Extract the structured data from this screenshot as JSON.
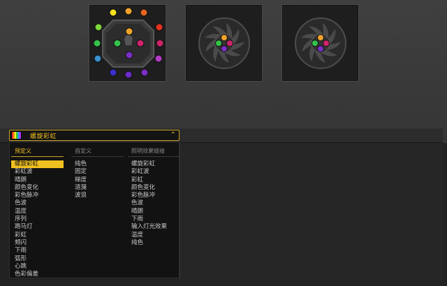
{
  "devices": [
    {
      "name": "fan-controller",
      "ring_leds": [
        "#f5e11d",
        "#f0a32a",
        "#e5651f",
        "#e3311f",
        "#d0236b",
        "#b43ac4",
        "#7a2fc4",
        "#6a2cc6",
        "#3a30c8",
        "#3a8fd0",
        "#34c24a",
        "#7fd63a"
      ],
      "hub_leds": [
        "#f0a32a",
        "#d0236b",
        "#7a2fc4",
        "#34c24a"
      ]
    },
    {
      "name": "fan-1",
      "hub_leds": [
        "#f0a32a",
        "#d0236b",
        "#7a2fc4",
        "#34c24a"
      ]
    },
    {
      "name": "fan-2",
      "hub_leds": [
        "#f0a32a",
        "#d0236b",
        "#7a2fc4",
        "#34c24a"
      ]
    }
  ],
  "effect_select": {
    "value": "螺旋彩虹"
  },
  "dropdown": {
    "columns": [
      {
        "header": "预定义",
        "active": true,
        "items": [
          "螺旋彩虹",
          "彩虹波",
          "晴朗",
          "颜色变化",
          "彩色脉冲",
          "色波",
          "温度",
          "序列",
          "跑马灯",
          "彩虹",
          "频闪",
          "下雨",
          "弧形",
          "心跳",
          "色彩偏差"
        ]
      },
      {
        "header": "自定义",
        "active": false,
        "items": [
          "纯色",
          "固定",
          "梯度",
          "涟漪",
          "波浪"
        ]
      },
      {
        "header": "照明效果链接",
        "active": false,
        "items": [
          "螺旋彩虹",
          "彩虹波",
          "彩虹",
          "颜色变化",
          "彩色脉冲",
          "色波",
          "晴朗",
          "下雨",
          "输入灯光效果",
          "温度",
          "纯色"
        ]
      }
    ],
    "selected": "螺旋彩虹"
  },
  "colors": {
    "accent": "#f0c020",
    "background": "#333333",
    "panel": "#1e1e1e"
  }
}
